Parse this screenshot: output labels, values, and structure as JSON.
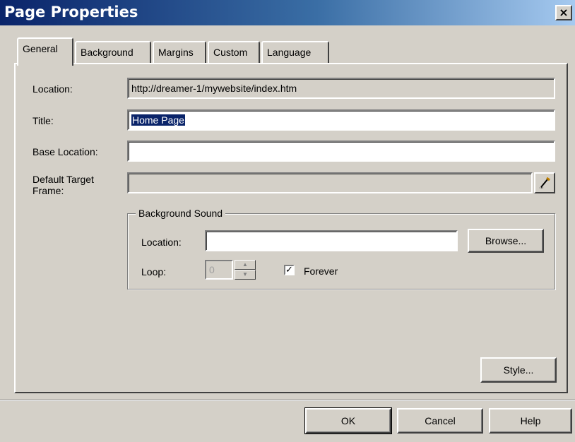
{
  "window": {
    "title": "Page Properties",
    "close_symbol": "×"
  },
  "tabs": [
    {
      "label": "General",
      "active": true
    },
    {
      "label": "Background",
      "active": false
    },
    {
      "label": "Margins",
      "active": false
    },
    {
      "label": "Custom",
      "active": false
    },
    {
      "label": "Language",
      "active": false
    }
  ],
  "general": {
    "location_label": "Location:",
    "location_value": "http://dreamer-1/mywebsite/index.htm",
    "title_label": "Title:",
    "title_value": "Home Page",
    "base_location_label": "Base Location:",
    "base_location_value": "",
    "default_target_label_line1": "Default Target",
    "default_target_label_line2": "Frame:",
    "default_target_value": ""
  },
  "background_sound": {
    "group_label": "Background Sound",
    "location_label": "Location:",
    "location_value": "",
    "browse_label": "Browse...",
    "loop_label": "Loop:",
    "loop_value": "0",
    "forever_label": "Forever",
    "forever_checked": true,
    "check_symbol": "✓"
  },
  "buttons": {
    "style_label": "Style...",
    "ok_label": "OK",
    "cancel_label": "Cancel",
    "help_label": "Help"
  },
  "icons": {
    "pencil": "pencil-icon",
    "spin_up": "▲",
    "spin_down": "▼"
  },
  "colors": {
    "titlebar_start": "#0a246a",
    "titlebar_end": "#a6caf0",
    "selection": "#0a246a",
    "face": "#d4d0c8"
  }
}
